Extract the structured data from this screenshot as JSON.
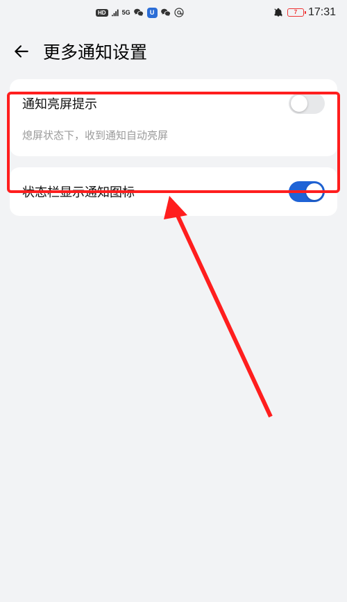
{
  "statusbar": {
    "hd": "HD",
    "net": "5G",
    "u": "U",
    "battery_text": "7",
    "time": "17:31"
  },
  "header": {
    "title": "更多通知设置"
  },
  "settings": {
    "group1": {
      "item1": {
        "label": "通知亮屏提示",
        "on": false
      },
      "desc": "熄屏状态下，收到通知自动亮屏"
    },
    "group2": {
      "item1": {
        "label": "状态栏显示通知图标",
        "on": true
      }
    }
  }
}
